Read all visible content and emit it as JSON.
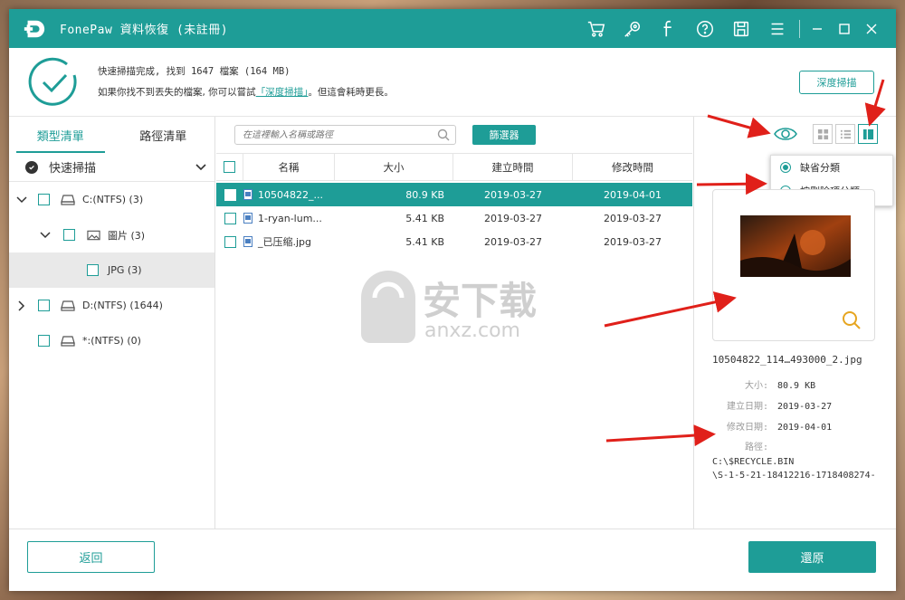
{
  "app": {
    "title": "FonePaw 資料恢復 (未註冊)"
  },
  "titlebar_icons": [
    "cart-icon",
    "key-icon",
    "facebook-icon",
    "help-icon",
    "save-icon",
    "menu-icon"
  ],
  "status": {
    "line1": "快速掃描完成, 找到 1647 檔案 (164 MB)",
    "line2_prefix": "如果你找不到丟失的檔案, 你可以嘗試",
    "line2_link": "「深度掃描」",
    "line2_suffix": "。但這會耗時更長。",
    "deep_scan_button": "深度掃描"
  },
  "left": {
    "tabs": [
      {
        "label": "類型清單",
        "active": true
      },
      {
        "label": "路徑清單",
        "active": false
      }
    ],
    "scan_mode": "快速掃描",
    "tree": [
      {
        "label": "C:(NTFS) (3)"
      },
      {
        "label": "圖片 (3)"
      },
      {
        "label": "JPG (3)"
      },
      {
        "label": "D:(NTFS) (1644)"
      },
      {
        "label": "*:(NTFS) (0)"
      }
    ]
  },
  "center": {
    "search_placeholder": "在這裡輸入名稱或路徑",
    "filter_button": "篩選器",
    "columns": [
      "名稱",
      "大小",
      "建立時間",
      "修改時間"
    ],
    "rows": [
      {
        "name": "10504822_...",
        "size": "80.9 KB",
        "created": "2019-03-27",
        "modified": "2019-04-01",
        "selected": true
      },
      {
        "name": "1-ryan-lum...",
        "size": "5.41 KB",
        "created": "2019-03-27",
        "modified": "2019-03-27",
        "selected": false
      },
      {
        "name": "_已压缩.jpg",
        "size": "5.41 KB",
        "created": "2019-03-27",
        "modified": "2019-03-27",
        "selected": false
      }
    ],
    "watermark_text": "安下载",
    "watermark_url": "anxz.com"
  },
  "right": {
    "dropdown": [
      {
        "label": "缺省分類",
        "selected": true
      },
      {
        "label": "按刪除項分類",
        "selected": false
      }
    ],
    "file_name": "10504822_114…493000_2.jpg",
    "meta": [
      {
        "key": "大小:",
        "value": "80.9 KB"
      },
      {
        "key": "建立日期:",
        "value": "2019-03-27"
      },
      {
        "key": "修改日期:",
        "value": "2019-04-01"
      }
    ],
    "path_label": "路徑:",
    "path_line1": "C:\\$RECYCLE.BIN",
    "path_line2": "\\S-1-5-21-18412216-1718408274-"
  },
  "bottom": {
    "back_button": "返回",
    "restore_button": "還原"
  },
  "colors": {
    "accent": "#1e9d97",
    "annotation": "#e0201a"
  }
}
